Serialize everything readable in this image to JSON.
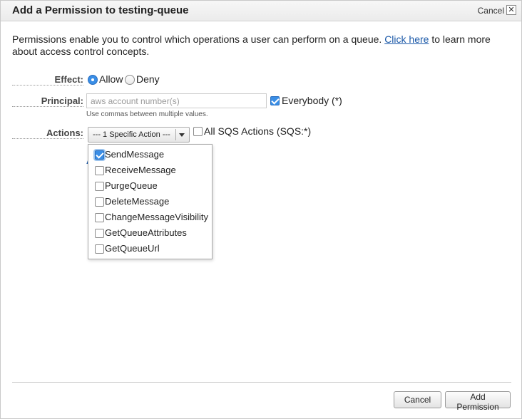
{
  "dialog": {
    "title": "Add a Permission to testing-queue",
    "cancel_link": "Cancel",
    "close_glyph": "✕"
  },
  "intro": {
    "text_before": "Permissions enable you to control which operations a user can perform on a queue. ",
    "link": "Click here",
    "text_after": " to learn more about access control concepts."
  },
  "effect": {
    "label": "Effect:",
    "options": [
      "Allow",
      "Deny"
    ],
    "selected": "Allow"
  },
  "principal": {
    "label": "Principal:",
    "placeholder": "aws account number(s)",
    "value": "",
    "hint": "Use commas between multiple values.",
    "everybody_label": "Everybody (*)",
    "everybody_checked": true
  },
  "actions": {
    "label": "Actions:",
    "select_value": "--- 1 Specific Action ---",
    "all_label": "All SQS Actions (SQS:*)",
    "all_checked": false,
    "partial_link_glyph": "A",
    "items": [
      {
        "label": "SendMessage",
        "checked": true
      },
      {
        "label": "ReceiveMessage",
        "checked": false
      },
      {
        "label": "PurgeQueue",
        "checked": false
      },
      {
        "label": "DeleteMessage",
        "checked": false
      },
      {
        "label": "ChangeMessageVisibility",
        "checked": false
      },
      {
        "label": "GetQueueAttributes",
        "checked": false
      },
      {
        "label": "GetQueueUrl",
        "checked": false
      }
    ]
  },
  "footer": {
    "cancel_button": "Cancel",
    "add_button": "Add Permission"
  },
  "colors": {
    "accent": "#3a8ee6",
    "link": "#1a58a8"
  }
}
